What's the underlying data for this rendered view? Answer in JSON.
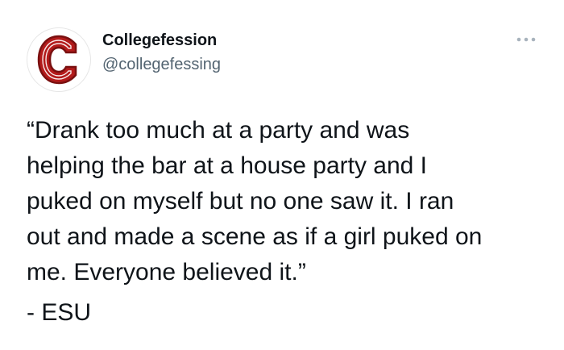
{
  "tweet": {
    "avatar": {
      "icon": "college-c-logo-icon",
      "letter": "C",
      "brand_color": "#b31b1b"
    },
    "display_name": "Collegefession",
    "handle": "@collegefessing",
    "more_icon": "more-horizontal-icon",
    "text": "“Drank too much at a party and was\nhelping the bar at a house party and I\npuked on myself but no one saw it. I ran\nout and made a scene as if a girl puked on\nme. Everyone believed it.”",
    "signature": "- ESU"
  }
}
